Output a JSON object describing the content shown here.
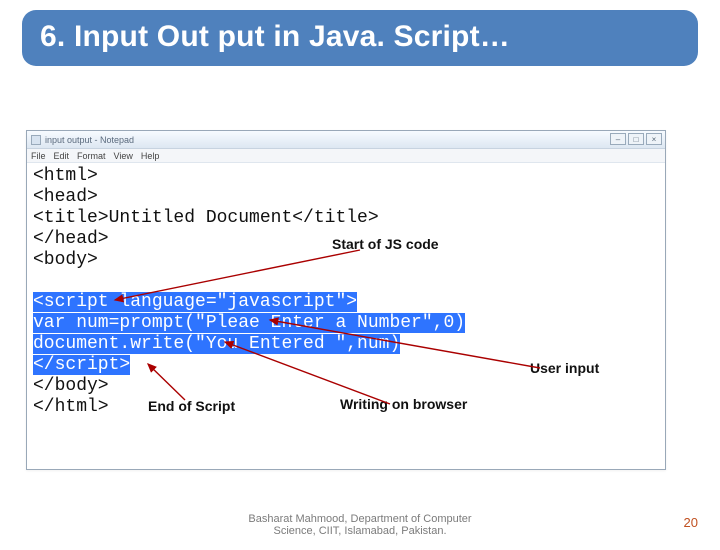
{
  "slide": {
    "title": "6. Input Out put in Java. Script…",
    "page_number": "20",
    "footer": "Basharat Mahmood, Department of Computer Science, CIIT, Islamabad, Pakistan."
  },
  "notepad": {
    "window_title": "input output - Notepad",
    "menus": [
      "File",
      "Edit",
      "Format",
      "View",
      "Help"
    ],
    "win_buttons": [
      "–",
      "□",
      "×"
    ]
  },
  "code": {
    "l1": "<html>",
    "l2": "<head>",
    "l3": "<title>Untitled Document</title>",
    "l4": "</head>",
    "l5": "<body>",
    "l6": "<script language=\"javascript\">",
    "l7": "var num=prompt(\"Pleae Enter a Number\",0)",
    "l8": "document.write(\"You Entered \",num)",
    "l9": "</script>",
    "l10": "</body>",
    "l11": "</html>"
  },
  "annotations": {
    "start_js": "Start of JS code",
    "user_input": "User input",
    "end_script": "End of Script",
    "writing": "Writing on browser"
  }
}
